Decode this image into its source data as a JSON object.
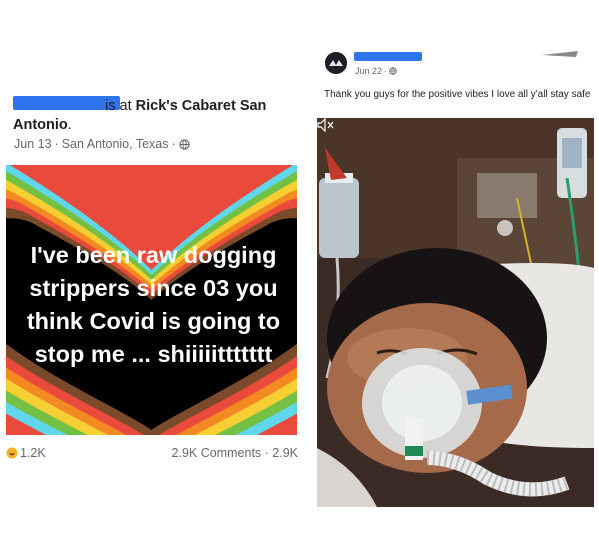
{
  "left_post": {
    "checkin": {
      "prefix": "is at ",
      "place_line1": "Rick's Cabaret San",
      "place_line2": "Antonio",
      "suffix": "."
    },
    "meta": {
      "date": "Jun 13",
      "dot1": " · ",
      "location": "San Antonio, Texas",
      "dot2": " · ",
      "privacy_icon": "globe-icon"
    },
    "background_post_text": [
      "I've been raw dogging",
      "strippers since 03  you",
      "think Covid is going to",
      "stop me ... shiiiiittttttt"
    ],
    "reactions": {
      "count": "1.2K",
      "comments": "2.9K Comments",
      "separator": " · ",
      "shares": "2.9K"
    }
  },
  "right_post": {
    "date": "Jun 22",
    "dot": " · ",
    "privacy_icon": "globe-icon",
    "caption": "Thank you guys for the positive vibes I love all y'all stay safe",
    "video_muted_icon": "speaker-muted-icon"
  },
  "colors": {
    "redaction_blue": "#2f73ee",
    "meta_gray": "#65676b",
    "text_dark": "#1c1e21"
  }
}
